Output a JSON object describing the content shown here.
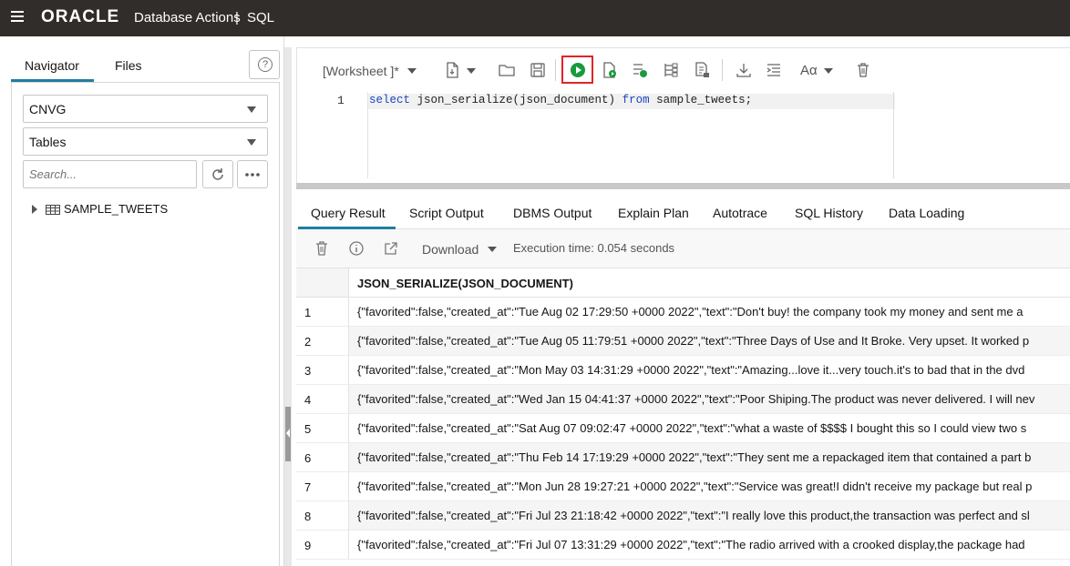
{
  "topbar": {
    "logo": "ORACLE",
    "app_title": "Database Actions",
    "separator": "|",
    "page": "SQL"
  },
  "left_panel": {
    "tabs": [
      "Navigator",
      "Files"
    ],
    "help_icon": "?",
    "schema_select": "CNVG",
    "object_type_select": "Tables",
    "search_placeholder": "Search...",
    "tree_items": [
      "SAMPLE_TWEETS"
    ]
  },
  "toolbar": {
    "worksheet_label": "[Worksheet ]*",
    "icons": [
      "new-worksheet-icon",
      "open-folder-icon",
      "save-icon",
      "run-statement-icon",
      "run-script-icon",
      "explain-plan-icon",
      "autotrace-icon",
      "sql-history-icon",
      "download-icon",
      "format-icon",
      "font-size-icon",
      "clear-icon"
    ],
    "font_icon_label": "Aα"
  },
  "editor": {
    "line_number": "1",
    "keyword_select": "select",
    "function_text": " json_serialize(json_document) ",
    "keyword_from": "from",
    "table_text": " sample_tweets;"
  },
  "result_tabs": [
    "Query Result",
    "Script Output",
    "DBMS Output",
    "Explain Plan",
    "Autotrace",
    "SQL History",
    "Data Loading"
  ],
  "result_toolbar": {
    "download_label": "Download",
    "execution_time": "Execution time: 0.054 seconds"
  },
  "grid": {
    "column": "JSON_SERIALIZE(JSON_DOCUMENT)",
    "rows": [
      {
        "num": "1",
        "text": "{\"favorited\":false,\"created_at\":\"Tue Aug 02 17:29:50 +0000 2022\",\"text\":\"Don't buy! the company took my money and sent me a"
      },
      {
        "num": "2",
        "text": "{\"favorited\":false,\"created_at\":\"Tue Aug 05 11:79:51 +0000 2022\",\"text\":\"Three Days of Use and It Broke. Very upset. It worked p"
      },
      {
        "num": "3",
        "text": "{\"favorited\":false,\"created_at\":\"Mon May 03 14:31:29 +0000 2022\",\"text\":\"Amazing...love it...very touch.it's to bad that in the dvd"
      },
      {
        "num": "4",
        "text": "{\"favorited\":false,\"created_at\":\"Wed Jan 15 04:41:37 +0000 2022\",\"text\":\"Poor Shiping.The product was never delivered. I will nev"
      },
      {
        "num": "5",
        "text": "{\"favorited\":false,\"created_at\":\"Sat Aug 07 09:02:47 +0000 2022\",\"text\":\"what a waste of $$$$ I bought this so I could view two s"
      },
      {
        "num": "6",
        "text": "{\"favorited\":false,\"created_at\":\"Thu Feb 14 17:19:29 +0000 2022\",\"text\":\"They sent me a repackaged item that contained a part b"
      },
      {
        "num": "7",
        "text": "{\"favorited\":false,\"created_at\":\"Mon Jun 28 19:27:21 +0000 2022\",\"text\":\"Service was great!I didn't receive my package but real p"
      },
      {
        "num": "8",
        "text": "{\"favorited\":false,\"created_at\":\"Fri Jul 23 21:18:42 +0000 2022\",\"text\":\"I really love this product,the transaction was perfect and sl"
      },
      {
        "num": "9",
        "text": "{\"favorited\":false,\"created_at\":\"Fri Jul 07 13:31:29 +0000 2022\",\"text\":\"The radio arrived with a crooked display,the package had"
      }
    ]
  },
  "colors": {
    "topbar": "#312d2a",
    "accent": "#227e9e",
    "run_green": "#1a9a3d",
    "highlight_red": "#e0242a",
    "keyword_blue": "#1b45bd"
  }
}
